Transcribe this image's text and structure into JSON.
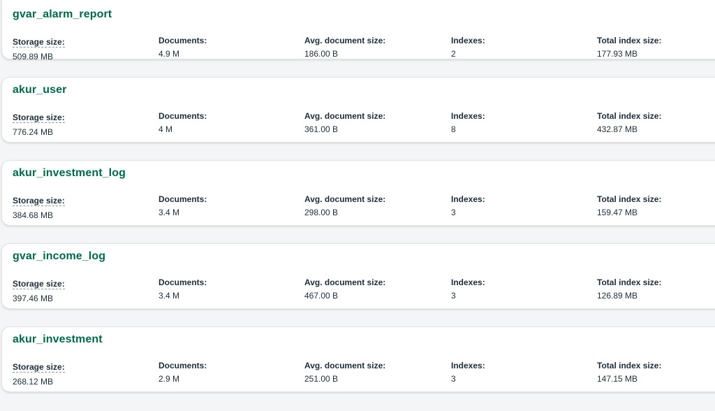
{
  "labels": {
    "storage_size": "Storage size:",
    "documents": "Documents:",
    "avg_document_size": "Avg. document size:",
    "indexes": "Indexes:",
    "total_index_size": "Total index size:"
  },
  "colors": {
    "collection_title": "#00684a",
    "text": "#1c2d38",
    "card_background": "#ffffff",
    "page_background": "#f4f5f6"
  },
  "collections": [
    {
      "name": "gvar_alarm_report",
      "storage_size": "509.89 MB",
      "documents": "4.9 M",
      "avg_document_size": "186.00 B",
      "indexes": "2",
      "total_index_size": "177.93 MB"
    },
    {
      "name": "akur_user",
      "storage_size": "776.24 MB",
      "documents": "4 M",
      "avg_document_size": "361.00 B",
      "indexes": "8",
      "total_index_size": "432.87 MB"
    },
    {
      "name": "akur_investment_log",
      "storage_size": "384.68 MB",
      "documents": "3.4 M",
      "avg_document_size": "298.00 B",
      "indexes": "3",
      "total_index_size": "159.47 MB"
    },
    {
      "name": "gvar_income_log",
      "storage_size": "397.46 MB",
      "documents": "3.4 M",
      "avg_document_size": "467.00 B",
      "indexes": "3",
      "total_index_size": "126.89 MB"
    },
    {
      "name": "akur_investment",
      "storage_size": "268.12 MB",
      "documents": "2.9 M",
      "avg_document_size": "251.00 B",
      "indexes": "3",
      "total_index_size": "147.15 MB"
    }
  ]
}
